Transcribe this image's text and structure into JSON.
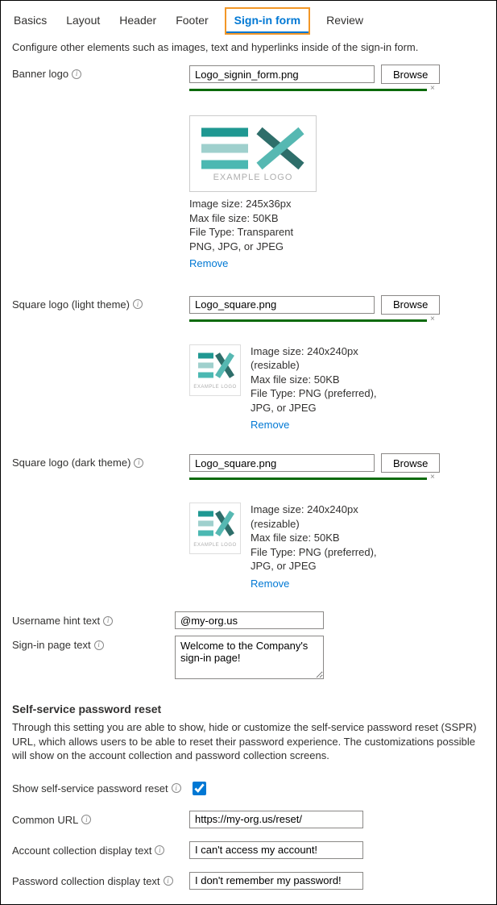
{
  "tabs": {
    "basics": "Basics",
    "layout": "Layout",
    "header": "Header",
    "footer": "Footer",
    "signin": "Sign-in form",
    "review": "Review"
  },
  "intro": "Configure other elements such as images, text and hyperlinks inside of the sign-in form.",
  "banner": {
    "label": "Banner logo",
    "filename": "Logo_signin_form.png",
    "browse": "Browse",
    "spec1": "Image size: 245x36px",
    "spec2": "Max file size: 50KB",
    "spec3": "File Type: Transparent PNG, JPG, or JPEG",
    "remove": "Remove",
    "logo_caption": "EXAMPLE LOGO"
  },
  "square_light": {
    "label": "Square logo (light theme)",
    "filename": "Logo_square.png",
    "browse": "Browse",
    "spec1": "Image size: 240x240px (resizable)",
    "spec2": "Max file size: 50KB",
    "spec3": "File Type: PNG (preferred), JPG, or JPEG",
    "remove": "Remove",
    "logo_caption": "EXAMPLE LOGO"
  },
  "square_dark": {
    "label": "Square logo (dark theme)",
    "filename": "Logo_square.png",
    "browse": "Browse",
    "spec1": "Image size: 240x240px (resizable)",
    "spec2": "Max file size: 50KB",
    "spec3": "File Type: PNG (preferred), JPG, or JPEG",
    "remove": "Remove",
    "logo_caption": "EXAMPLE LOGO"
  },
  "username_hint": {
    "label": "Username hint text",
    "value": "@my-org.us"
  },
  "signin_text": {
    "label": "Sign-in page text",
    "value": "Welcome to the Company's sign-in page!"
  },
  "sspr": {
    "heading": "Self-service password reset",
    "description": "Through this setting you are able to show, hide or customize the self-service password reset (SSPR) URL, which allows users to be able to reset their password experience. The customizations possible will show on the account collection and password collection screens.",
    "show_label": "Show self-service password reset",
    "show_checked": true,
    "common_url_label": "Common URL",
    "common_url_value": "https://my-org.us/reset/",
    "account_label": "Account collection display text",
    "account_value": "I can't access my account!",
    "password_label": "Password collection display text",
    "password_value": "I don't remember my password!"
  }
}
